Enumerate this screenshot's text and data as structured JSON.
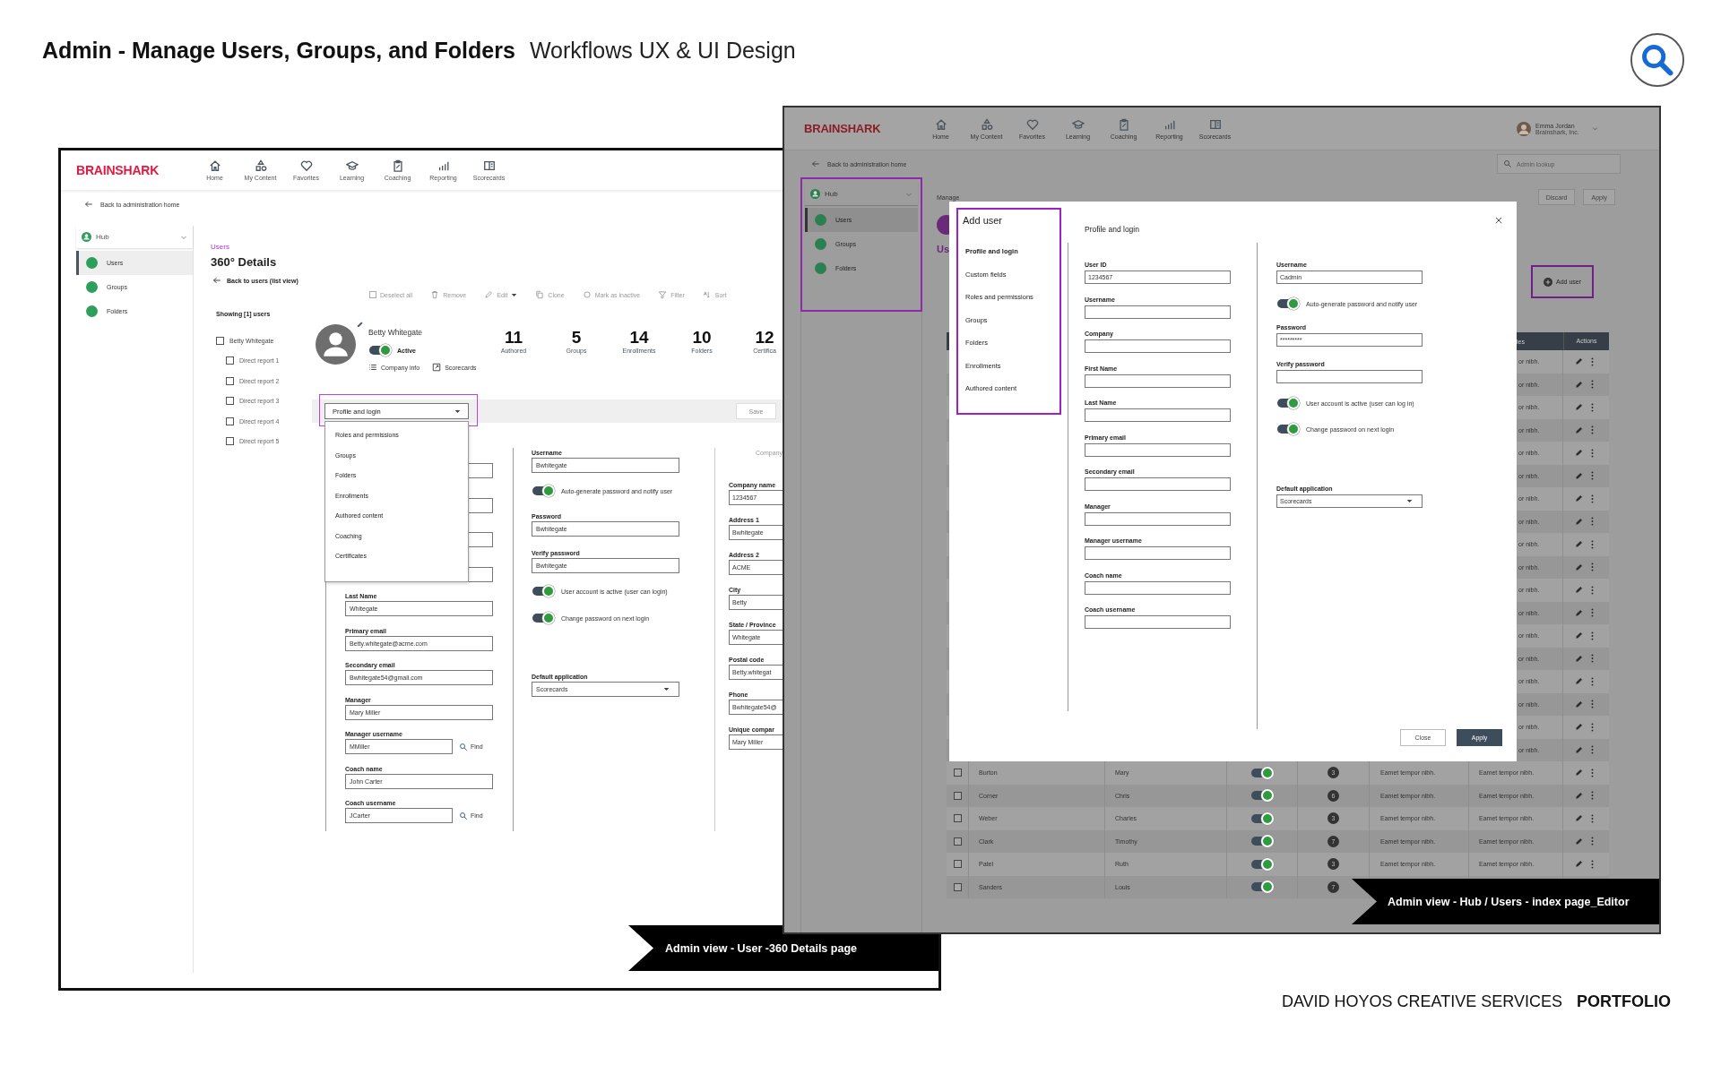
{
  "header": {
    "title": "Admin - Manage Users, Groups, and Folders",
    "subtitle": "Workflows UX & UI Design"
  },
  "detail_screen": {
    "logo": "BRAINSHARK",
    "nav": [
      "Home",
      "My Content",
      "Favorites",
      "Learning",
      "Coaching",
      "Reporting",
      "Scorecards"
    ],
    "back_link": "Back to administration home",
    "sidebar": {
      "title": "Hub",
      "items": [
        {
          "label": "Users",
          "selected": true
        },
        {
          "label": "Groups",
          "selected": false
        },
        {
          "label": "Folders",
          "selected": false
        }
      ]
    },
    "breadcrumb": "Users",
    "heading": "360° Details",
    "back_to_list": "Back to users (list view)",
    "toolbar": [
      {
        "kind": "checkbox",
        "label": "Deselect all",
        "disabled": true
      },
      {
        "kind": "trash",
        "label": "Remove",
        "disabled": true
      },
      {
        "kind": "edit",
        "label": "Edit",
        "disabled": true
      },
      {
        "kind": "clone",
        "label": "Clone",
        "disabled": true
      },
      {
        "kind": "radio",
        "label": "Mark as inactive",
        "disabled": true
      },
      {
        "kind": "filter",
        "label": "Filter",
        "disabled": true
      },
      {
        "kind": "sort",
        "label": "Sort",
        "disabled": true
      }
    ],
    "showing": "Showing [1] users",
    "user_tree": {
      "label": "Betty Whitegate",
      "checked": false,
      "children": [
        {
          "label": "Direct report 1",
          "checked": false
        },
        {
          "label": "Direct report 2",
          "checked": false
        },
        {
          "label": "Direct report 3",
          "checked": false
        },
        {
          "label": "Direct report 4",
          "checked": false
        },
        {
          "label": "Direct report 5",
          "checked": false
        }
      ]
    },
    "profile": {
      "name": "Betty Whitegate",
      "active": true,
      "status": "Active",
      "links": [
        {
          "kind": "list",
          "label": "Company info"
        },
        {
          "kind": "external",
          "label": "Scorecards"
        }
      ]
    },
    "stats": [
      {
        "value": "11",
        "label": "Authored"
      },
      {
        "value": "5",
        "label": "Groups"
      },
      {
        "value": "14",
        "label": "Enrollments"
      },
      {
        "value": "10",
        "label": "Folders"
      },
      {
        "value": "12",
        "label": "Certifica"
      }
    ],
    "section_select": {
      "value": "Profile and login",
      "options": [
        "Roles and permissions",
        "Groups",
        "Folders",
        "Enrollments",
        "Authored content",
        "Coaching",
        "Certificates"
      ]
    },
    "save": "Save",
    "personal_fields": [
      {
        "kind": "input"
      },
      {
        "kind": "input"
      },
      {
        "kind": "input"
      },
      {
        "kind": "input"
      },
      {
        "kind": "input",
        "label": "Last Name",
        "value": "Whitegate"
      },
      {
        "kind": "input",
        "label": "Primary email",
        "value": "Betty.whitegate@acme.com"
      },
      {
        "kind": "input",
        "label": "Secondary email",
        "value": "Bwhitegate54@gmail.com"
      },
      {
        "kind": "input",
        "label": "Manager",
        "value": "Mary Miller"
      },
      {
        "kind": "input",
        "label": "Manager username",
        "value": "MMiller",
        "action": "Find"
      },
      {
        "kind": "input",
        "label": "Coach name",
        "value": "John Carter"
      },
      {
        "kind": "input",
        "label": "Coach username",
        "value": "JCarter",
        "action": "Find"
      }
    ],
    "account_fields": [
      {
        "kind": "input",
        "label": "Username",
        "value": "Bwhitegate"
      },
      {
        "kind": "toggle",
        "label": "Auto-generate password and notify user",
        "on": true
      },
      {
        "kind": "input",
        "label": "Password",
        "value": "Bwhitegate"
      },
      {
        "kind": "input",
        "label": "Verify password",
        "value": "Bwhitegate"
      },
      {
        "kind": "toggle",
        "label": "User account is active (user can login)",
        "on": true
      },
      {
        "kind": "toggle",
        "label": "Change password on next login",
        "on": true
      },
      {
        "kind": "select",
        "label": "Default application",
        "value": "Scorecards"
      }
    ],
    "company": {
      "title": "Company",
      "fields": [
        {
          "label": "Company name",
          "value": "1234567"
        },
        {
          "label": "Address 1",
          "value": "Bwhitegate"
        },
        {
          "label": "Address 2",
          "value": "ACME"
        },
        {
          "label": "City",
          "value": "Betty"
        },
        {
          "label": "State / Province",
          "value": "Whitegate"
        },
        {
          "label": "Postal code",
          "value": "Betty.whitegat"
        },
        {
          "label": "Phone",
          "value": "Bwhitegate54@"
        },
        {
          "label": "Unique compar",
          "value": "Mary Miller"
        }
      ]
    },
    "caption": "Admin view - User -360 Details page"
  },
  "index_screen": {
    "logo": "BRAINSHARK",
    "nav": [
      "Home",
      "My Content",
      "Favorites",
      "Learning",
      "Coaching",
      "Reporting",
      "Scorecards"
    ],
    "user": {
      "name": "Emma Jordan",
      "org": "Brainshark, Inc."
    },
    "back_link": "Back to administration home",
    "search": {
      "placeholder": "Admin lookup"
    },
    "sidebar": {
      "title": "Hub",
      "items": [
        {
          "label": "Users",
          "selected": true
        },
        {
          "label": "Groups",
          "selected": false
        },
        {
          "label": "Folders",
          "selected": false
        }
      ]
    },
    "section_label": "Manage",
    "title": "Us",
    "actions": [
      "Discard",
      "Apply"
    ],
    "add_button": "Add user",
    "table": {
      "columns": [
        "les",
        "Actions"
      ],
      "rows": [
        {
          "kind": "partial",
          "column_7": "or nibh."
        },
        {
          "kind": "partial",
          "column_7": "or nibh."
        },
        {
          "kind": "partial",
          "column_7": "or nibh."
        },
        {
          "kind": "partial",
          "column_7": "or nibh."
        },
        {
          "kind": "partial",
          "column_7": "or nibh."
        },
        {
          "kind": "partial",
          "column_7": "or nibh."
        },
        {
          "kind": "partial",
          "column_7": "or nibh."
        },
        {
          "kind": "partial",
          "column_7": "or nibh."
        },
        {
          "kind": "partial",
          "column_7": "or nibh."
        },
        {
          "kind": "partial",
          "column_7": "or nibh."
        },
        {
          "kind": "partial",
          "column_7": "or nibh."
        },
        {
          "kind": "partial",
          "column_7": "or nibh."
        },
        {
          "kind": "partial",
          "column_7": "or nibh."
        },
        {
          "kind": "partial",
          "column_7": "or nibh."
        },
        {
          "kind": "partial",
          "column_7": "or nibh."
        },
        {
          "kind": "partial",
          "column_7": "or nibh."
        },
        {
          "kind": "partial",
          "column_7": "or nibh."
        },
        {
          "kind": "partial",
          "column_7": "or nibh."
        },
        {
          "kind": "full",
          "checked": false,
          "column_2": "Burton",
          "column_3": "Mary",
          "on": true,
          "column_5": "3",
          "column_6": "Eamet tempor nibh.",
          "column_7": "Eamet tempor nibh."
        },
        {
          "kind": "full",
          "checked": false,
          "column_2": "Corner",
          "column_3": "Chris",
          "on": true,
          "column_5": "6",
          "column_6": "Eamet tempor nibh.",
          "column_7": "Eamet tempor nibh."
        },
        {
          "kind": "full",
          "checked": false,
          "column_2": "Weber",
          "column_3": "Charles",
          "on": true,
          "column_5": "3",
          "column_6": "Eamet tempor nibh.",
          "column_7": "Eamet tempor nibh."
        },
        {
          "kind": "full",
          "checked": false,
          "column_2": "Clark",
          "column_3": "Timothy",
          "on": true,
          "column_5": "7",
          "column_6": "Eamet tempor nibh.",
          "column_7": "Eamet tempor nibh."
        },
        {
          "kind": "full",
          "checked": false,
          "column_2": "Patel",
          "column_3": "Ruth",
          "on": true,
          "column_5": "3",
          "column_6": "Eamet tempor nibh.",
          "column_7": "Eamet tempor nibh."
        },
        {
          "kind": "full",
          "checked": false,
          "column_2": "Sanders",
          "column_3": "Louis",
          "on": true,
          "column_5": "7"
        }
      ]
    },
    "modal": {
      "title": "Add user",
      "nav": [
        {
          "label": "Profile and login",
          "selected": true
        },
        {
          "label": "Custom fields",
          "selected": false
        },
        {
          "label": "Roles and permissions",
          "selected": false
        },
        {
          "label": "Groups",
          "selected": false
        },
        {
          "label": "Folders",
          "selected": false
        },
        {
          "label": "Enrollments",
          "selected": false
        },
        {
          "label": "Authored content",
          "selected": false
        }
      ],
      "heading": "Profile and login",
      "fields": [
        {
          "label": "User ID",
          "value": "1234567"
        },
        {
          "label": "Username"
        },
        {
          "label": "Company"
        },
        {
          "label": "First Name"
        },
        {
          "label": "Last Name"
        },
        {
          "label": "Primary email"
        },
        {
          "label": "Secondary email"
        },
        {
          "label": "Manager"
        },
        {
          "label": "Manager username"
        },
        {
          "label": "Coach name"
        },
        {
          "label": "Coach username"
        }
      ],
      "settings": [
        {
          "kind": "input",
          "label": "Username",
          "value": "Cadmin"
        },
        {
          "kind": "toggle",
          "label": "Auto-generate password and notify user",
          "on": true
        },
        {
          "kind": "input",
          "label": "Password",
          "value": "*********"
        },
        {
          "kind": "input",
          "label": "Verify password"
        },
        {
          "kind": "toggle",
          "label": "User account is active (user can log in)",
          "on": true
        },
        {
          "kind": "toggle",
          "label": "Change password on next login",
          "on": true
        },
        {
          "kind": "select",
          "label": "Default application",
          "value": "Scorecards"
        }
      ],
      "buttons": [
        {
          "label": "Close",
          "primary": false
        },
        {
          "label": "Apply",
          "primary": true
        }
      ]
    },
    "caption": "Admin view - Hub / Users - index page_Editor"
  },
  "footer": {
    "studio": "DAVID HOYOS CREATIVE SERVICES",
    "label": "PORTFOLIO"
  }
}
